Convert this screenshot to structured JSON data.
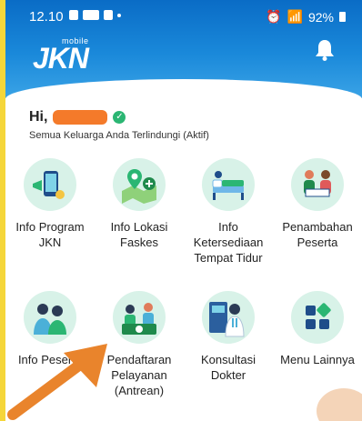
{
  "statusbar": {
    "time": "12.10",
    "battery": "92%"
  },
  "header": {
    "logo_small": "mobile",
    "logo_main": "JKN"
  },
  "greeting": {
    "hi": "Hi,",
    "status": "Semua Keluarga Anda Terlindungi (Aktif)"
  },
  "menu": [
    {
      "label": "Info Program JKN",
      "icon": "phone-megaphone-icon"
    },
    {
      "label": "Info Lokasi Faskes",
      "icon": "map-location-icon"
    },
    {
      "label": "Info Ketersediaan Tempat Tidur",
      "icon": "hospital-bed-icon"
    },
    {
      "label": "Penambahan Peserta",
      "icon": "registration-icon"
    },
    {
      "label": "Info Peserta",
      "icon": "family-icon"
    },
    {
      "label": "Pendaftaran Pelayanan (Antrean)",
      "icon": "queue-registration-icon"
    },
    {
      "label": "Konsultasi Dokter",
      "icon": "doctor-icon"
    },
    {
      "label": "Menu Lainnya",
      "icon": "grid-menu-icon"
    }
  ],
  "colors": {
    "header": "#1a89da",
    "accent": "#2bb673",
    "arrow": "#e9842c",
    "border": "#f5d63a"
  }
}
